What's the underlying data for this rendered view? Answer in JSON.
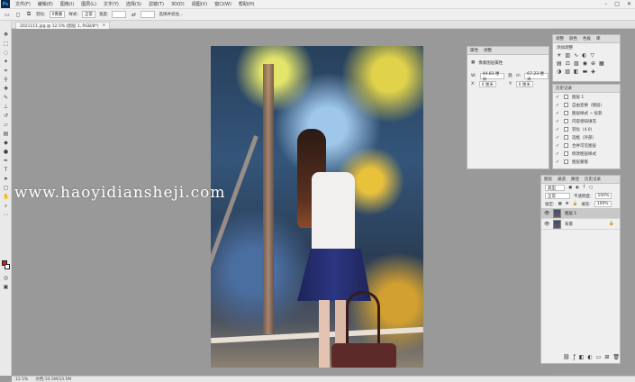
{
  "app": {
    "logo": "Ps"
  },
  "menu": [
    "文件(F)",
    "编辑(E)",
    "图像(I)",
    "图层(L)",
    "文字(Y)",
    "选择(S)",
    "滤镜(T)",
    "3D(D)",
    "视图(V)",
    "窗口(W)",
    "帮助(H)"
  ],
  "window_controls": [
    "–",
    "□",
    "✕"
  ],
  "options_bar": {
    "feather_label": "羽化:",
    "feather_value": "0像素",
    "style_label": "样式:",
    "style_value": "正常",
    "width_label": "宽度:",
    "refine_label": "选择并遮住..."
  },
  "document_tab": {
    "title": "2021111.jpg @ 12.5% (图层 1, RGB/8*)",
    "close": "×"
  },
  "properties_panel": {
    "tabs": [
      "属性",
      "调整"
    ],
    "title": "像素图层属性",
    "w_label": "W:",
    "w_value": "44.81 厘米",
    "h_label": "H:",
    "h_value": "67.23 厘米",
    "x_label": "X:",
    "x_value": "0 厘米",
    "y_label": "Y:",
    "y_value": "0 厘米"
  },
  "adjust_panel": {
    "tabs": [
      "调整",
      "颜色",
      "色板",
      "库"
    ],
    "add_label": "添加调整"
  },
  "history_panel": {
    "tab": "历史记录",
    "items": [
      "图层 1",
      "自由变换（图层）",
      "图层样式 ~ 投影",
      "内容感知填充",
      "羽化（4.0）",
      "选框（外部）",
      "合并可见图层",
      "修改图层样式",
      "图层蒙版",
      "剪贴蒙版"
    ]
  },
  "layers_panel": {
    "tabs": [
      "图层",
      "通道",
      "路径",
      "历史记录"
    ],
    "kind_label": "类型",
    "blend_mode": "正常",
    "opacity_label": "不透明度:",
    "opacity_value": "100%",
    "fill_label": "填充:",
    "fill_value": "100%",
    "lock_label": "锁定:",
    "layers": [
      {
        "name": "图层 1",
        "selected": true
      },
      {
        "name": "背景",
        "selected": false
      }
    ]
  },
  "watermark": "www.haoyidiansheji.com",
  "status": {
    "zoom": "12.5%",
    "doc": "文档:33.5M/33.5M"
  },
  "colors": {
    "foreground": "#e01818",
    "background": "#ffffff",
    "workspace": "#999999"
  }
}
